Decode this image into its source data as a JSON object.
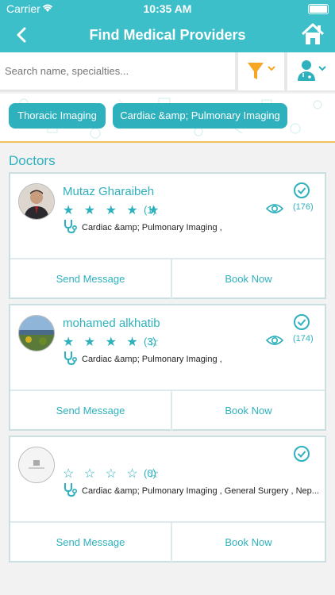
{
  "status": {
    "carrier": "Carrier",
    "time": "10:35 AM"
  },
  "nav": {
    "title": "Find Medical Providers"
  },
  "search": {
    "placeholder": "Search name, specialties..."
  },
  "chips": [
    "Thoracic Imaging",
    "Cardiac &amp; Pulmonary Imaging"
  ],
  "section_title": "Doctors",
  "colors": {
    "accent": "#3dbfca",
    "accent_dark": "#2eb1bd",
    "filter_icon": "#f5a623"
  },
  "doctors": [
    {
      "name": "Mutaz Gharaibeh",
      "stars": "★ ★ ★ ★ ★",
      "rating_count": "(1)",
      "specialties": "Cardiac &amp; Pulmonary Imaging ,",
      "views": "(176)",
      "send_message": "Send Message",
      "book_now": "Book Now"
    },
    {
      "name": "mohamed alkhatib",
      "stars": "★ ★ ★ ★ ☆",
      "rating_count": "(3)",
      "specialties": "Cardiac &amp; Pulmonary Imaging ,",
      "views": "(174)",
      "send_message": "Send Message",
      "book_now": "Book Now"
    },
    {
      "name": "",
      "stars": "☆ ☆ ☆ ☆ ☆",
      "rating_count": "(0)",
      "specialties": "Cardiac &amp; Pulmonary Imaging , General Surgery , Nep...",
      "views": "",
      "send_message": "Send Message",
      "book_now": "Book Now"
    }
  ]
}
